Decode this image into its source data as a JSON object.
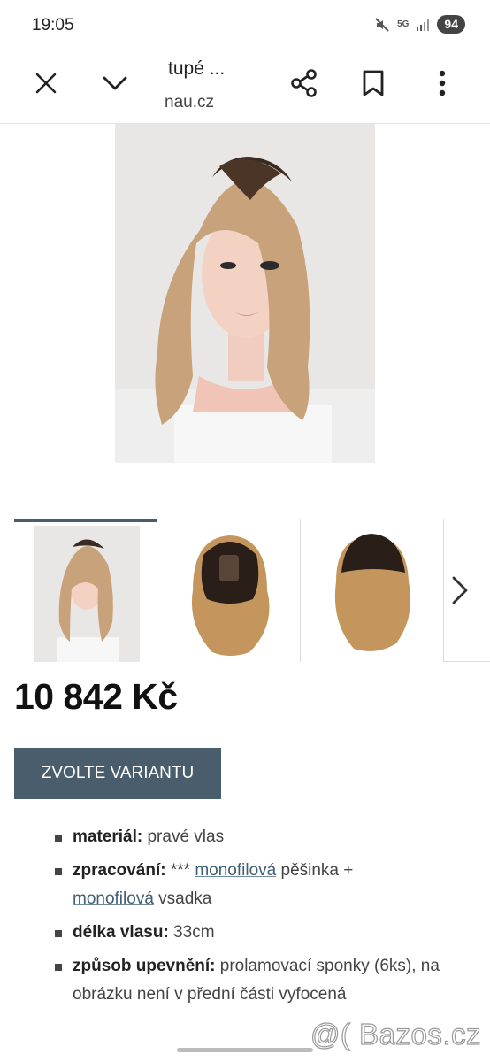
{
  "status_bar": {
    "time": "19:05",
    "network": "5G",
    "battery": "94",
    "icons": [
      "mute-icon",
      "signal-icon"
    ]
  },
  "top_bar": {
    "title": "tupé ...",
    "url": "nau.cz",
    "icons": [
      "close-icon",
      "chevron-down-icon",
      "share-icon",
      "bookmark-icon",
      "more-vert-icon"
    ]
  },
  "gallery": {
    "thumbnails": [
      "thumbnail-1",
      "thumbnail-2",
      "thumbnail-3"
    ],
    "next_icon": "chevron-right-icon"
  },
  "product": {
    "price": "10 842 Kč",
    "variant_button": "ZVOLTE VARIANTU"
  },
  "specs": [
    {
      "label": "materiál:",
      "text": " pravé vlas"
    },
    {
      "label": "zpracování:",
      "pre": " *** ",
      "link1": "monofilová",
      "mid": " pěšinka + ",
      "link2": "monofilová",
      "post": " vsadka"
    },
    {
      "label": "délka vlasu:",
      "text": " 33cm"
    },
    {
      "label": "způsob upevnění:",
      "text": " prolamovací sponky (6ks), na obrázku není v přední části vyfocená"
    }
  ],
  "watermark": "@( Bazos.cz"
}
